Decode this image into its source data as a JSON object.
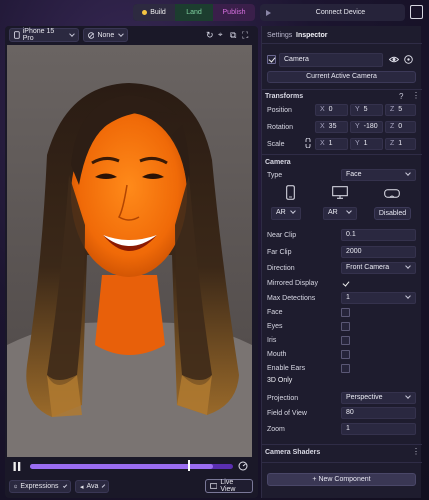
{
  "topbar": {
    "build_label": "Build",
    "land_label": "Land",
    "publish_label": "Publish",
    "connect_label": "Connect Device"
  },
  "viewport_toolbar": {
    "device_label": "iPhone 15 Pro",
    "filter_label": "None"
  },
  "bottombar": {
    "expressions_label": "Expressions",
    "avatar_label": "Ava",
    "live_view_label": "Live View"
  },
  "timeline": {
    "progress": 0.9
  },
  "inspector": {
    "tab_settings": "Settings",
    "tab_inspector": "Inspector",
    "object_name": "Camera",
    "active_camera_button": "Current Active Camera",
    "transforms": {
      "title": "Transforms",
      "position_label": "Position",
      "rotation_label": "Rotation",
      "scale_label": "Scale",
      "position": {
        "x": "0",
        "y": "5",
        "z": "5"
      },
      "rotation": {
        "x": "35",
        "y": "-180",
        "z": "0"
      },
      "scale": {
        "x": "1",
        "y": "1",
        "z": "1"
      },
      "axis_x": "X",
      "axis_y": "Y",
      "axis_z": "Z"
    },
    "camera": {
      "title": "Camera",
      "type_label": "Type",
      "type_value": "Face",
      "phone_mode": "AR",
      "desktop_mode": "AR",
      "headset_mode": "Disabled",
      "near_clip_label": "Near Clip",
      "near_clip": "0.1",
      "far_clip_label": "Far Clip",
      "far_clip": "2000",
      "direction_label": "Direction",
      "direction_value": "Front Camera",
      "mirrored_label": "Mirrored Display",
      "max_detections_label": "Max Detections",
      "max_detections": "1",
      "face_label": "Face",
      "eyes_label": "Eyes",
      "iris_label": "Iris",
      "mouth_label": "Mouth",
      "ears_label": "Enable Ears",
      "only3d_label": "3D Only",
      "projection_label": "Projection",
      "projection_value": "Perspective",
      "fov_label": "Field of View",
      "fov_value": "80",
      "zoom_label": "Zoom",
      "zoom_value": "1"
    },
    "shaders_title": "Camera Shaders",
    "new_component_label": "+ New Component"
  },
  "colors": {
    "accent_purple": "#9b6df2",
    "build_dot": "#f5c542",
    "land_green": "#7fd1a0",
    "publish_pink": "#d870e0"
  }
}
